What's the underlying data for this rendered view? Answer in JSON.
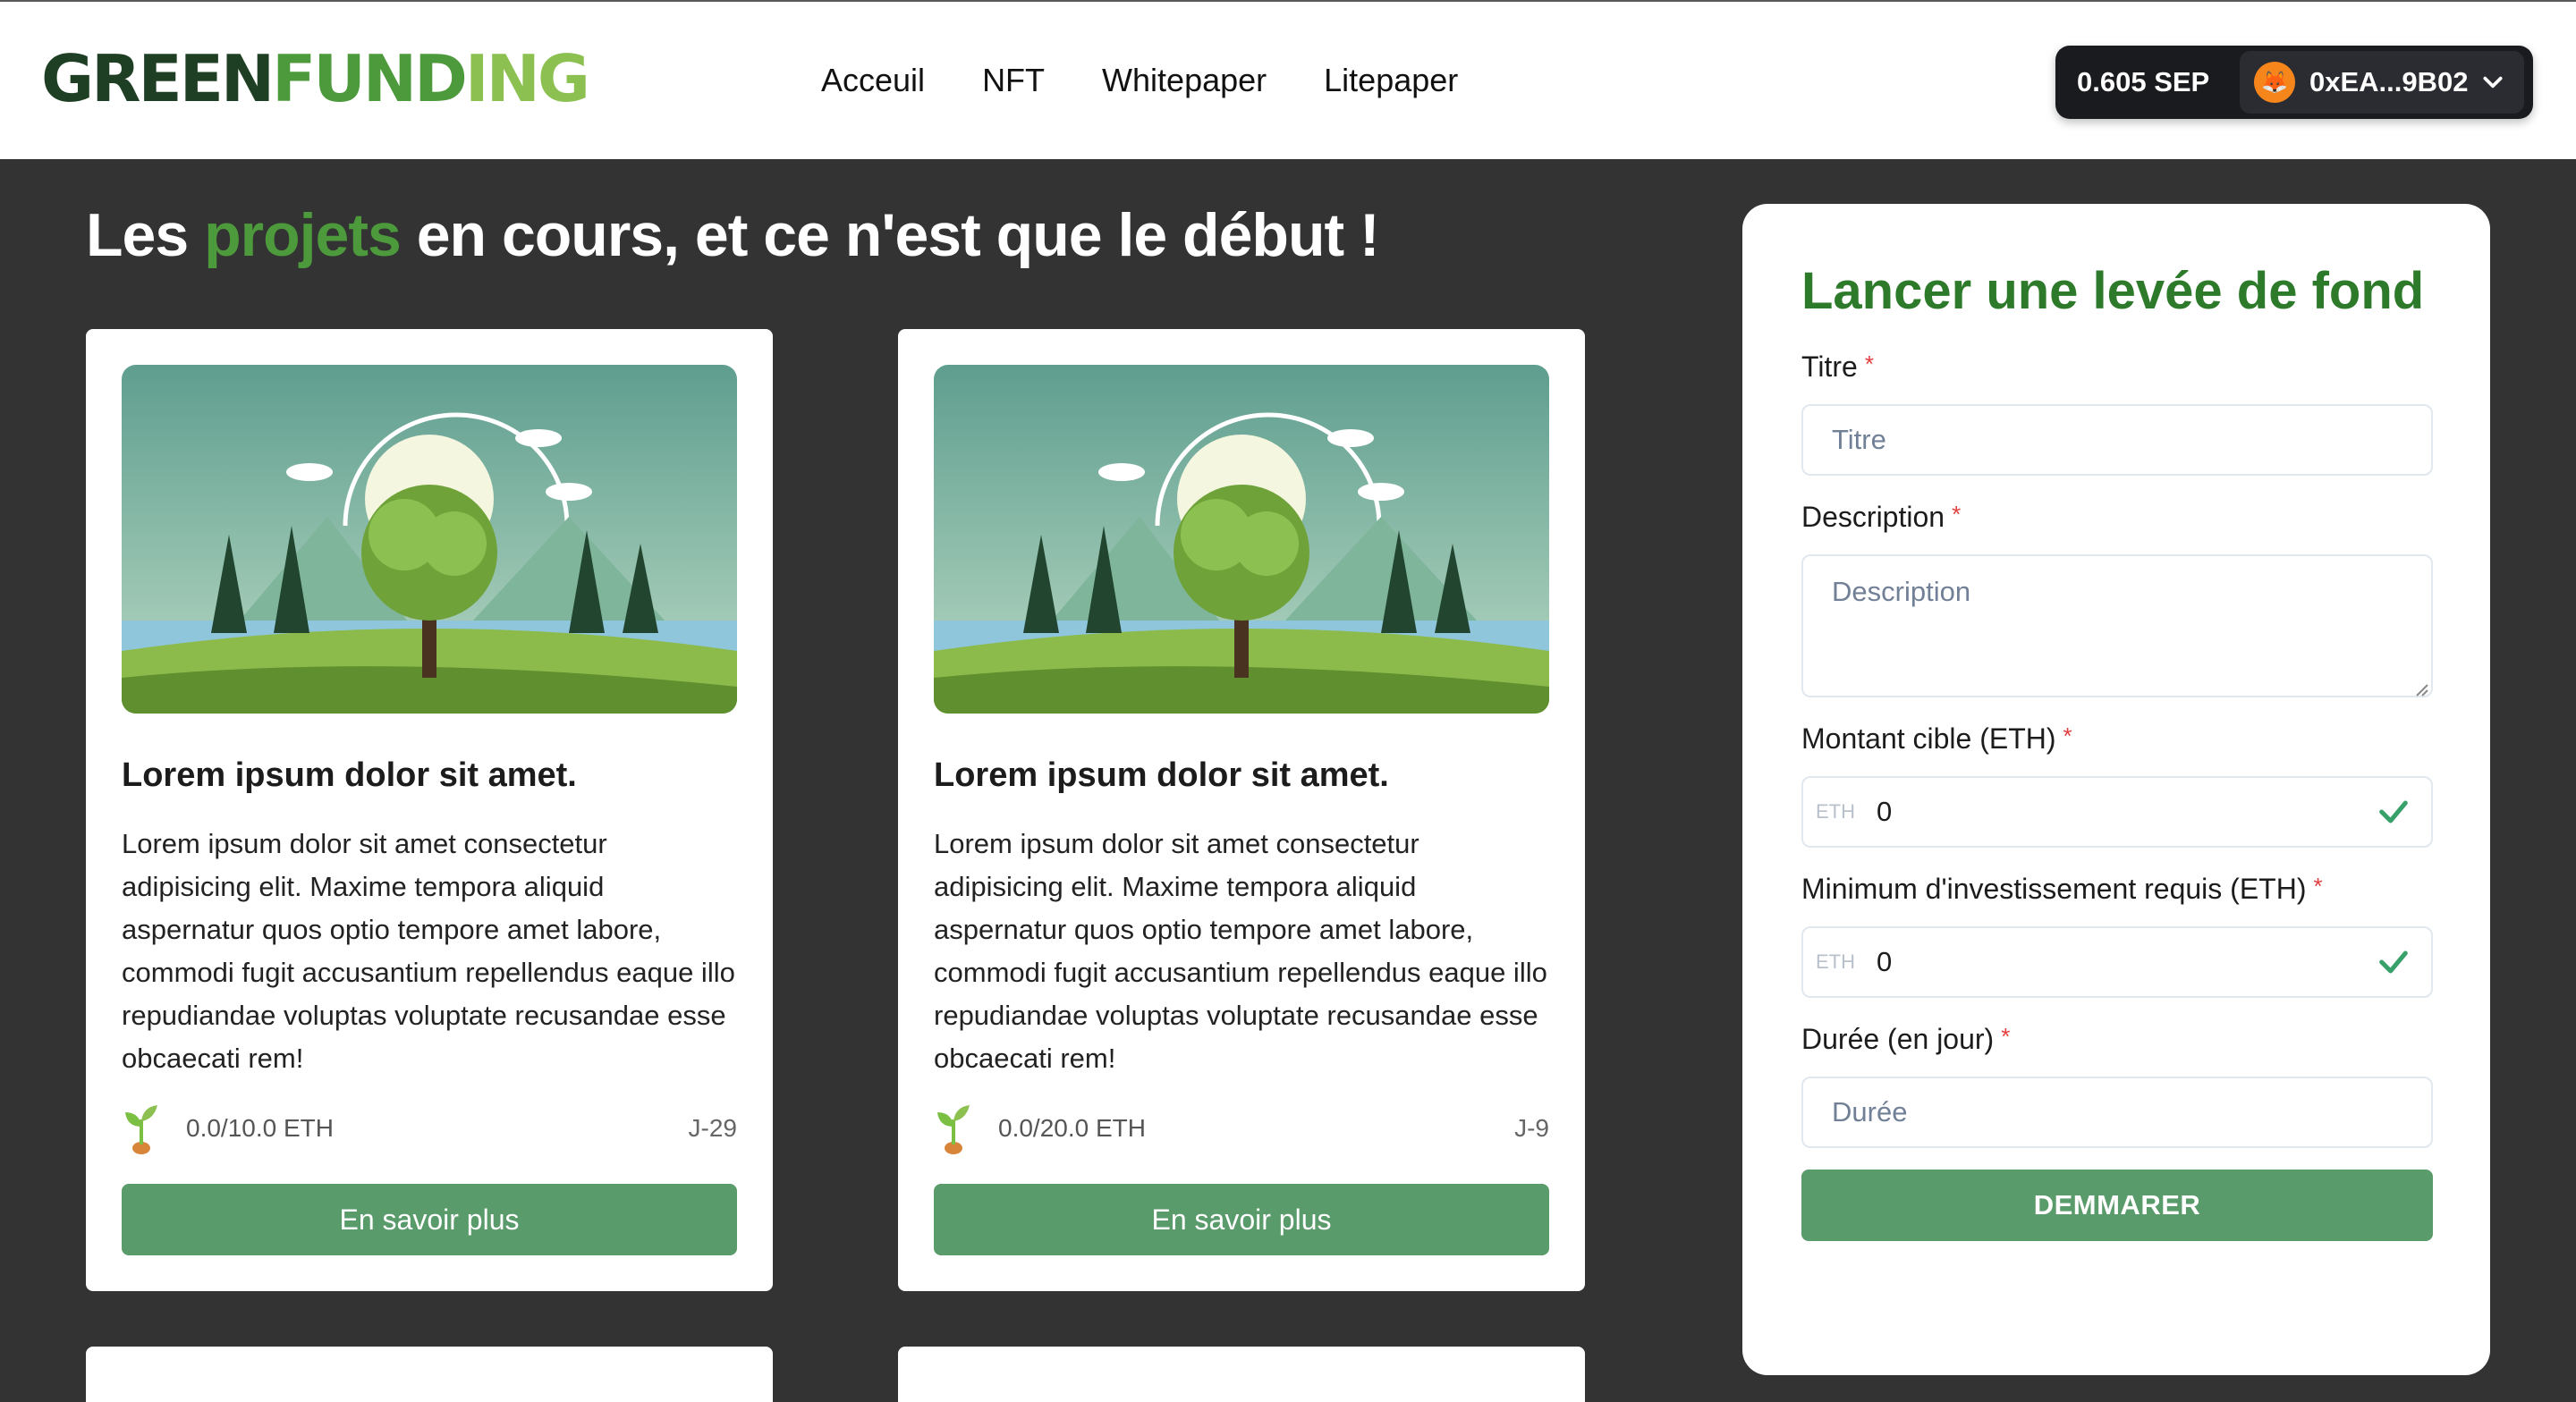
{
  "header": {
    "logo": "GREENFUNDING",
    "nav": [
      "Acceuil",
      "NFT",
      "Whitepaper",
      "Litepaper"
    ],
    "wallet": {
      "balance": "0.605 SEP",
      "address": "0xEA...9B02"
    }
  },
  "main": {
    "title_before": "Les ",
    "title_accent": "projets",
    "title_after": " en cours, et ce n'est que le début !",
    "projects": [
      {
        "title": "Lorem ipsum dolor sit amet.",
        "description": "Lorem ipsum dolor sit amet consectetur adipisicing elit. Maxime tempora aliquid aspernatur quos optio tempore amet labore, commodi fugit accusantium repellendus eaque illo repudiandae voluptas voluptate recusandae esse obcaecati rem!",
        "funds": "0.0/10.0 ETH",
        "days": "J-29",
        "button": "En savoir plus"
      },
      {
        "title": "Lorem ipsum dolor sit amet.",
        "description": "Lorem ipsum dolor sit amet consectetur adipisicing elit. Maxime tempora aliquid aspernatur quos optio tempore amet labore, commodi fugit accusantium repellendus eaque illo repudiandae voluptas voluptate recusandae esse obcaecati rem!",
        "funds": "0.0/20.0 ETH",
        "days": "J-9",
        "button": "En savoir plus"
      }
    ]
  },
  "form": {
    "title": "Lancer une levée de fond",
    "required_mark": "*",
    "fields": {
      "title": {
        "label": "Titre",
        "placeholder": "Titre"
      },
      "description": {
        "label": "Description",
        "placeholder": "Description"
      },
      "target": {
        "label": "Montant cible (ETH)",
        "prefix": "ETH",
        "value": "0"
      },
      "minimum": {
        "label": "Minimum d'investissement requis (ETH)",
        "prefix": "ETH",
        "value": "0"
      },
      "duration": {
        "label": "Durée (en jour)",
        "placeholder": "Durée"
      }
    },
    "submit": "DEMMARER"
  },
  "colors": {
    "brand_green": "#4c9a3b",
    "title_green": "#2c7a2a",
    "button_green": "#5a9b6b",
    "background": "#333333",
    "required_red": "#e53e3e"
  },
  "icons": [
    "metamask-fox-icon",
    "chevron-down-icon",
    "sprout-icon",
    "check-icon"
  ]
}
